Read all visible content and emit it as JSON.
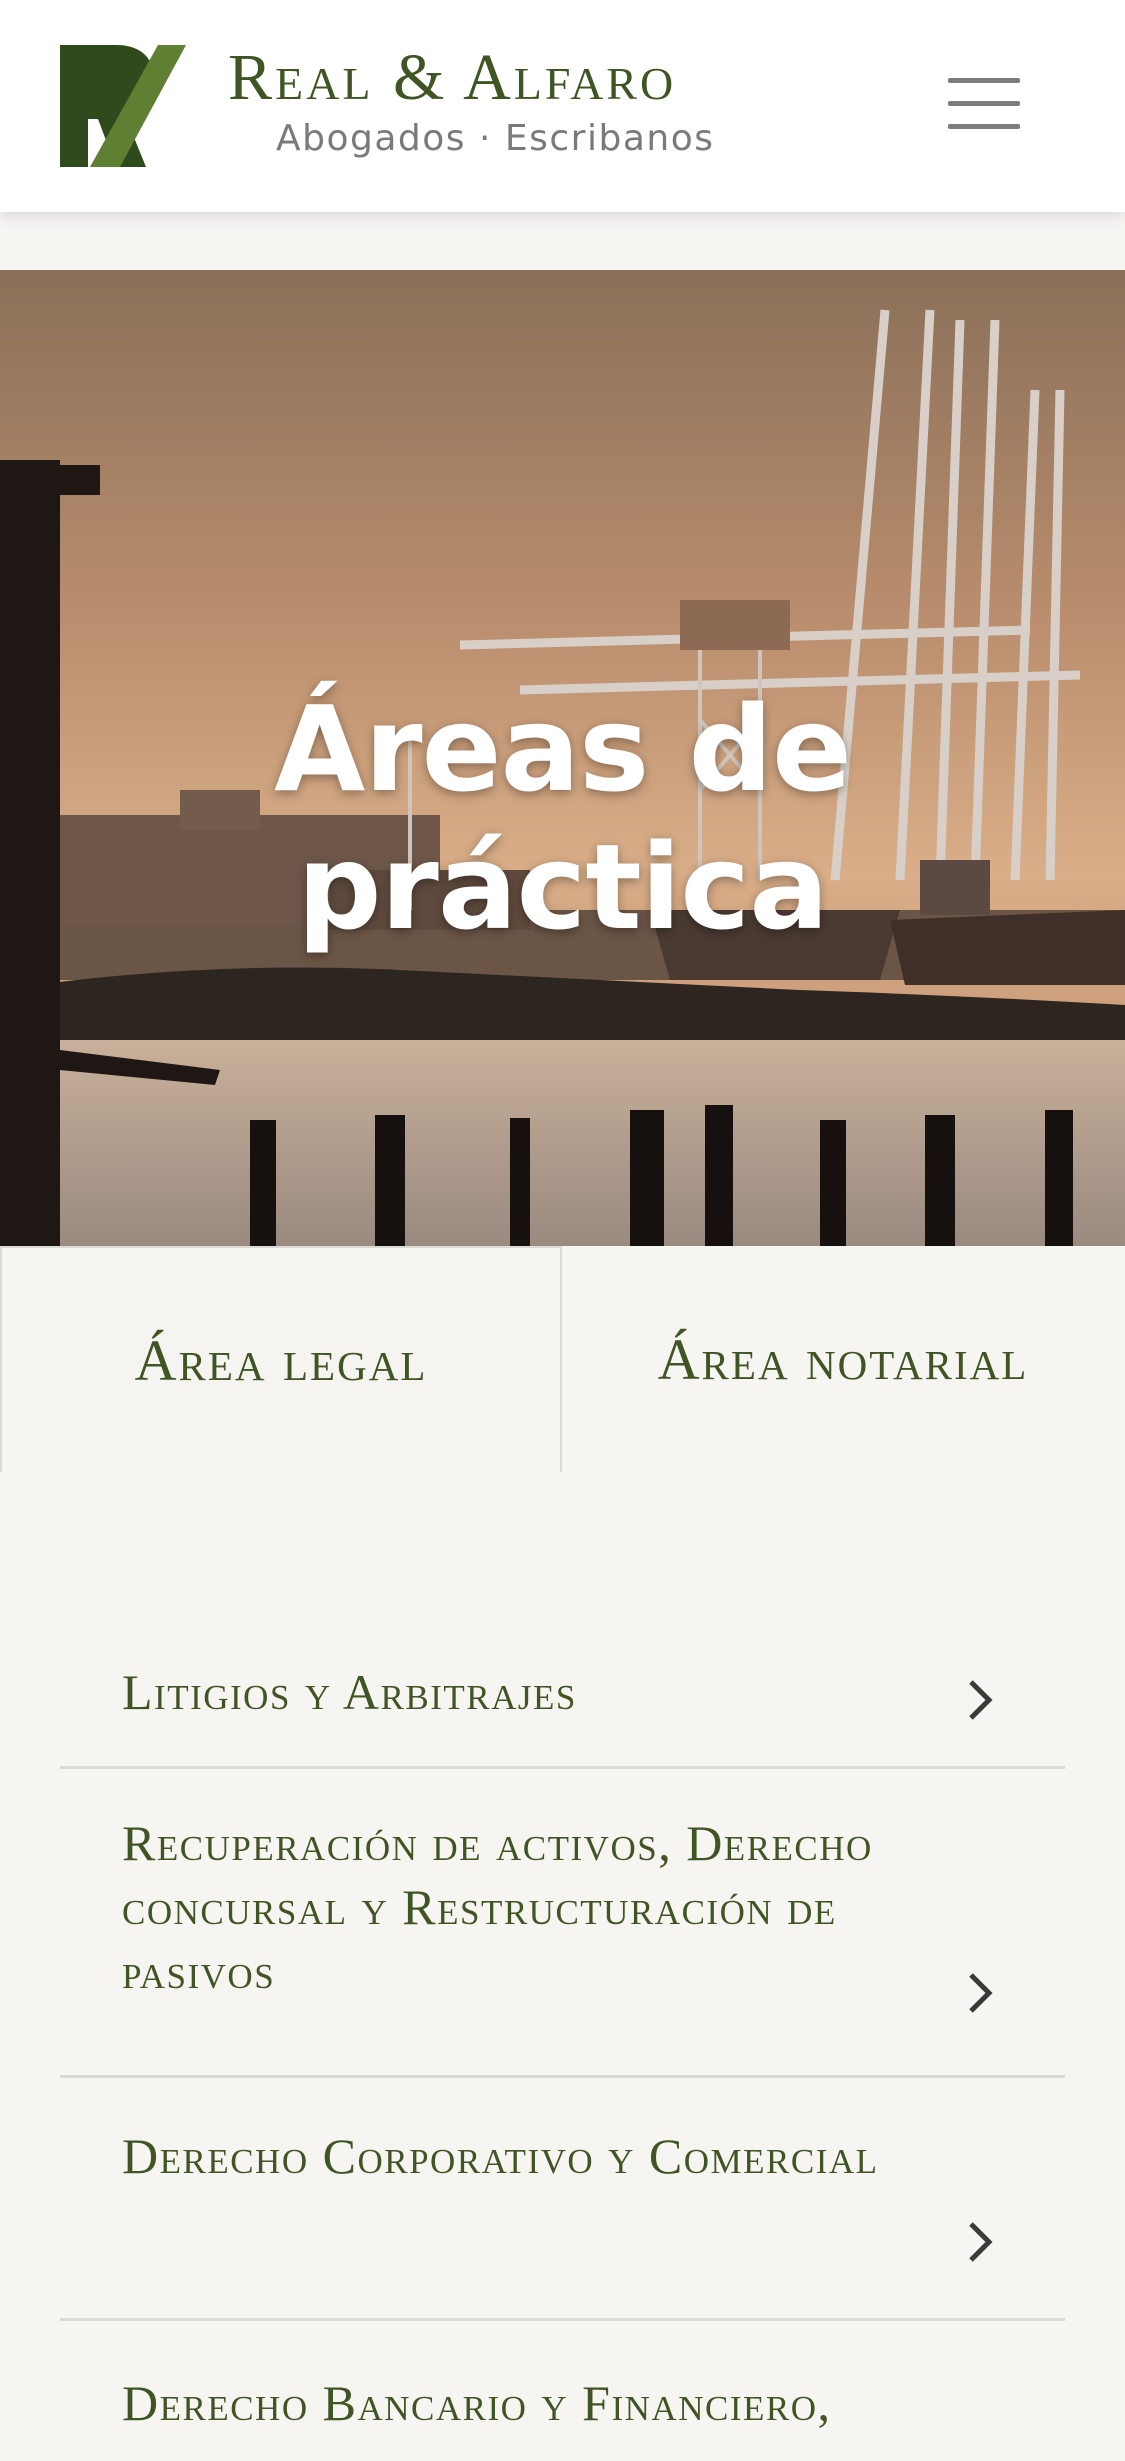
{
  "header": {
    "brand_name": "Real & Alfaro",
    "brand_subtitle": "Abogados · Escribanos",
    "logo_icon": "rv-monogram-icon",
    "menu_icon": "hamburger-menu-icon"
  },
  "hero": {
    "title": "Áreas de práctica"
  },
  "tabs": [
    {
      "label": "Área legal",
      "active": true
    },
    {
      "label": "Área notarial",
      "active": false
    }
  ],
  "practice_areas": [
    {
      "label": "Litigios y Arbitrajes"
    },
    {
      "label": "Recuperación de activos, Derecho concursal y Restructuración de pasivos"
    },
    {
      "label": "Derecho Corporativo y Comercial"
    },
    {
      "label": "Derecho Bancario y Financiero,"
    }
  ],
  "colors": {
    "brand_green": "#3f5524",
    "logo_dark": "#2f4a1c",
    "logo_light": "#5f7f33",
    "background": "#f7f5f2",
    "divider": "#dcdad6"
  }
}
